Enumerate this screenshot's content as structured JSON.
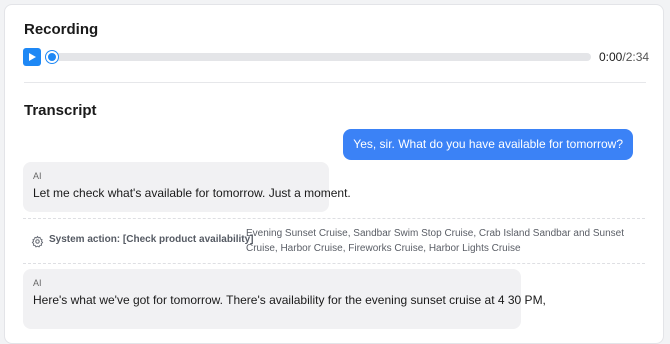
{
  "recording": {
    "title": "Recording",
    "current_time": "0:00",
    "separator": "/",
    "total_time": "2:34",
    "progress": 0
  },
  "transcript": {
    "title": "Transcript",
    "messages": [
      {
        "role": "user",
        "text": "Yes, sir. What do you have available for tomorrow?"
      },
      {
        "role": "ai",
        "speaker": "AI",
        "text": "Let me check what's available for tomorrow. Just a moment."
      },
      {
        "role": "system",
        "label": "System action: [Check product availability]",
        "products": "Evening Sunset Cruise, Sandbar Swim Stop Cruise, Crab Island Sandbar and Sunset Cruise, Harbor Cruise, Fireworks Cruise, Harbor Lights Cruise"
      },
      {
        "role": "ai",
        "speaker": "AI",
        "text": "Here's what we've got for tomorrow. There's availability for the evening sunset cruise at 4 30 PM,"
      }
    ]
  },
  "colors": {
    "accent": "#1e88f5",
    "user_bubble": "#3b82f6",
    "ai_bubble": "#f1f1f3"
  },
  "icons": {
    "play": "play-icon",
    "system": "gear-icon"
  }
}
